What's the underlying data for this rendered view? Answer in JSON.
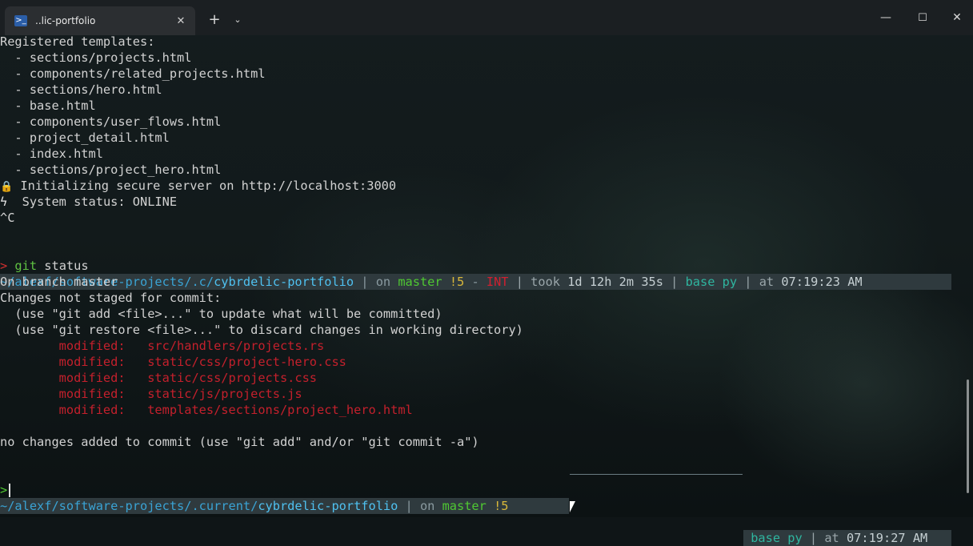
{
  "window": {
    "tab_title": "..lic-portfolio",
    "tab_icon": "powershell-icon",
    "close_tab": "✕",
    "new_tab": "+",
    "dropdown": "⌄",
    "minimize": "—",
    "maximize": "☐",
    "close": "✕"
  },
  "output": {
    "registered": "Registered templates:",
    "templates": [
      "  - sections/projects.html",
      "  - components/related_projects.html",
      "  - sections/hero.html",
      "  - base.html",
      "  - components/user_flows.html",
      "  - project_detail.html",
      "  - index.html",
      "  - sections/project_hero.html"
    ],
    "lock_icon": "🔒",
    "init": " Initializing secure server on http://localhost:3000",
    "bolt_icon": "ϟ",
    "status": "  System status: ONLINE",
    "interrupt": "^C"
  },
  "prompt1": {
    "path_prefix": "~/alexf/software-projects/",
    "path_mid": ".c/",
    "path_dir": "cybrdelic-portfolio",
    "on": " | on ",
    "branch": "master",
    "dirty": " !5",
    "dash": " - ",
    "err": "INT",
    "took_label": " | took ",
    "took": "1d 12h 2m 35s",
    "env_sep": " | ",
    "env": "base py",
    "at": " | at ",
    "time": "07:19:23 AM"
  },
  "command": {
    "prompt": ">",
    "git": " git",
    "args": " status"
  },
  "git_status": {
    "branch_line": "On branch master",
    "not_staged": "Changes not staged for commit:",
    "hint_add": "  (use \"git add <file>...\" to update what will be committed)",
    "hint_restore": "  (use \"git restore <file>...\" to discard changes in working directory)",
    "modified": [
      {
        "label": "        modified:   ",
        "file": "src/handlers/projects.rs"
      },
      {
        "label": "        modified:   ",
        "file": "static/css/project-hero.css"
      },
      {
        "label": "        modified:   ",
        "file": "static/css/projects.css"
      },
      {
        "label": "        modified:   ",
        "file": "static/js/projects.js"
      },
      {
        "label": "        modified:   ",
        "file": "templates/sections/project_hero.html"
      }
    ],
    "no_changes": "no changes added to commit (use \"git add\" and/or \"git commit -a\")"
  },
  "prompt2": {
    "path_prefix": "~/alexf/software-projects/",
    "path_mid": ".current/",
    "path_dir": "cybrdelic-portfolio",
    "on": " | on ",
    "branch": "master",
    "dirty": " !5",
    "env": "base py",
    "at": " | at ",
    "time": "07:19:27 AM"
  },
  "input_prompt": ">",
  "colors": {
    "background": "#0f1517",
    "titlebar": "#1b1f22",
    "prompt_bar": "#2f3a3e",
    "path": "#3aa3d4",
    "branch": "#4fc832",
    "dirty": "#d9b83a",
    "error": "#c4202c",
    "env": "#2fb6a0"
  }
}
